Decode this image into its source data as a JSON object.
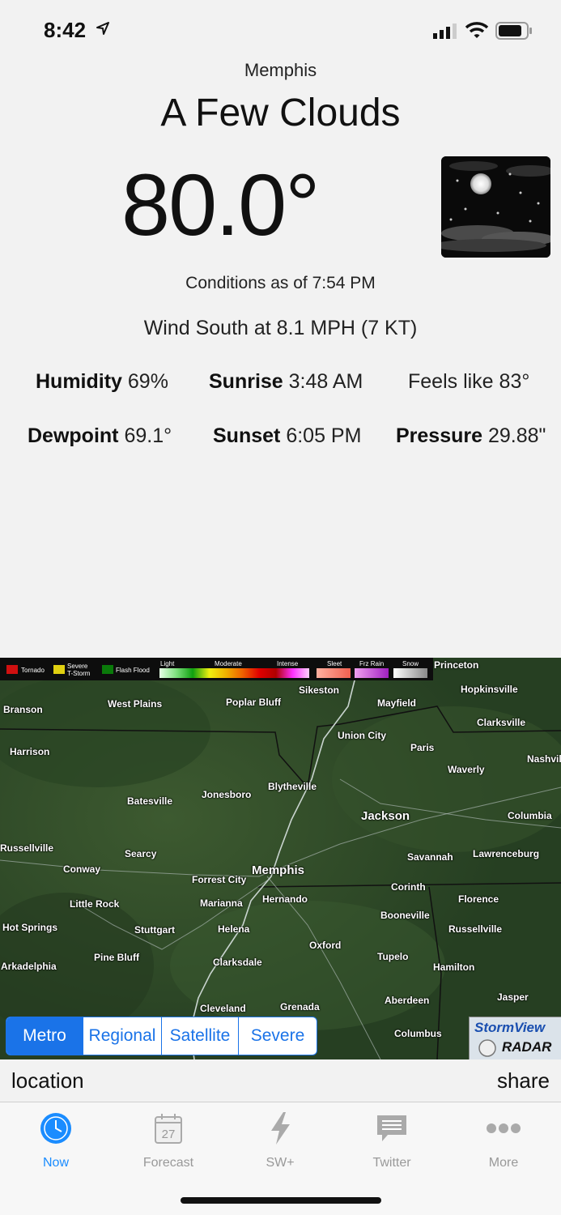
{
  "status_bar": {
    "time": "8:42"
  },
  "weather": {
    "city": "Memphis",
    "condition": "A Few Clouds",
    "temperature": "80.0°",
    "conditions_as_of": "Conditions as of 7:54 PM",
    "wind": "Wind South at 8.1 MPH (7 KT)",
    "humidity_label": "Humidity",
    "humidity_value": "69%",
    "sunrise_label": "Sunrise",
    "sunrise_value": "3:48 AM",
    "feels_like": "Feels like 83°",
    "dewpoint_label": "Dewpoint",
    "dewpoint_value": "69.1°",
    "sunset_label": "Sunset",
    "sunset_value": "6:05 PM",
    "pressure_label": "Pressure",
    "pressure_value": "29.88\"",
    "icon": "night-few-clouds-icon"
  },
  "radar": {
    "legend": {
      "tornado": "Tornado",
      "severe": "Severe",
      "tstorm": "T-Storm",
      "flash_flood": "Flash Flood",
      "light": "Light",
      "moderate": "Moderate",
      "intense": "Intense",
      "sleet": "Sleet",
      "frz_rain": "Frz Rain",
      "snow": "Snow"
    },
    "places": {
      "princeton": "Princeton",
      "sikeston": "Sikeston",
      "hopkinsville": "Hopkinsville",
      "branson": "Branson",
      "west_plains": "West Plains",
      "poplar_bluff": "Poplar Bluff",
      "mayfield": "Mayfield",
      "clarksville": "Clarksville",
      "union_city": "Union City",
      "harrison": "Harrison",
      "paris": "Paris",
      "nashville": "Nashvil",
      "waverly": "Waverly",
      "blytheville": "Blytheville",
      "batesville": "Batesville",
      "jonesboro": "Jonesboro",
      "jackson": "Jackson",
      "columbia": "Columbia",
      "russellville_ar": "Russellville",
      "searcy": "Searcy",
      "savannah": "Savannah",
      "lawrenceburg": "Lawrenceburg",
      "conway": "Conway",
      "memphis": "Memphis",
      "forrest_city": "Forrest City",
      "corinth": "Corinth",
      "little_rock": "Little Rock",
      "marianna": "Marianna",
      "hernando": "Hernando",
      "florence": "Florence",
      "booneville": "Booneville",
      "hot_springs": "Hot Springs",
      "stuttgart": "Stuttgart",
      "helena": "Helena",
      "russellville_al": "Russellville",
      "oxford": "Oxford",
      "pine_bluff": "Pine Bluff",
      "tupelo": "Tupelo",
      "arkadelphia": "Arkadelphia",
      "clarksdale": "Clarksdale",
      "hamilton": "Hamilton",
      "jasper": "Jasper",
      "aberdeen": "Aberdeen",
      "cleveland": "Cleveland",
      "grenada": "Grenada",
      "columbus": "Columbus"
    },
    "segments": [
      "Metro",
      "Regional",
      "Satellite",
      "Severe"
    ],
    "active_segment": "Metro",
    "stormview_line1": "StormView",
    "stormview_line2": "RADAR"
  },
  "actions": {
    "location": "location",
    "share": "share"
  },
  "tabs": [
    {
      "label": "Now",
      "icon": "clock-icon"
    },
    {
      "label": "Forecast",
      "icon": "calendar-icon",
      "badge": "27"
    },
    {
      "label": "SW+",
      "icon": "lightning-icon"
    },
    {
      "label": "Twitter",
      "icon": "chat-bubble-icon"
    },
    {
      "label": "More",
      "icon": "more-dots-icon"
    }
  ],
  "colors": {
    "accent": "#1a8cff",
    "segment_blue": "#1a73e8",
    "map_green": "#2f4a28"
  }
}
